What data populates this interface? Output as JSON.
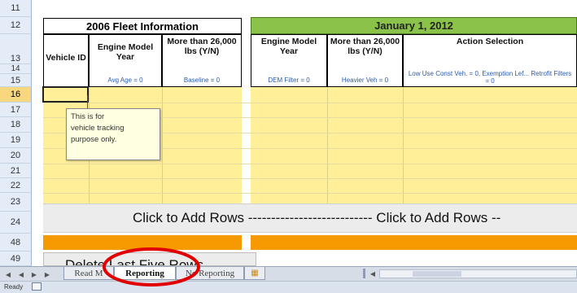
{
  "rows": [
    "11",
    "12",
    "13",
    "14",
    "15",
    "16",
    "17",
    "18",
    "19",
    "20",
    "21",
    "22",
    "23",
    "24",
    "48",
    "49"
  ],
  "section_headers": {
    "fleet_2006": "2006 Fleet Information",
    "jan_2012": "January 1, 2012"
  },
  "columns": [
    {
      "title": "Vehicle ID",
      "sub": ""
    },
    {
      "title": "Engine Model Year",
      "sub": "Avg Age = 0"
    },
    {
      "title": "More than 26,000 lbs (Y/N)",
      "sub": "Baseline = 0"
    },
    {
      "title": "Engine Model Year",
      "sub": "DEM Filter = 0"
    },
    {
      "title": "More than 26,000 lbs (Y/N)",
      "sub": "Heavier Veh = 0"
    },
    {
      "title": "Action Selection",
      "sub": "Low Use Const Veh. = 0, Exemption Lef... Retrofit Filters = 0"
    }
  ],
  "comment": {
    "lines": [
      "This is for",
      "vehicle tracking",
      "purpose only."
    ]
  },
  "add_rows_text": "Click to Add Rows --------------------------- Click to Add Rows --",
  "delete_button_text": "Delete Last Five Rows",
  "tabs": [
    "Read M",
    "Reporting",
    "No Reporting"
  ],
  "status": {
    "ready": "Ready"
  },
  "colors": {
    "yellow": "#ffef99",
    "green_header": "#8bc34a",
    "orange_bar": "#f59a00",
    "highlight_circle": "#e00000"
  }
}
